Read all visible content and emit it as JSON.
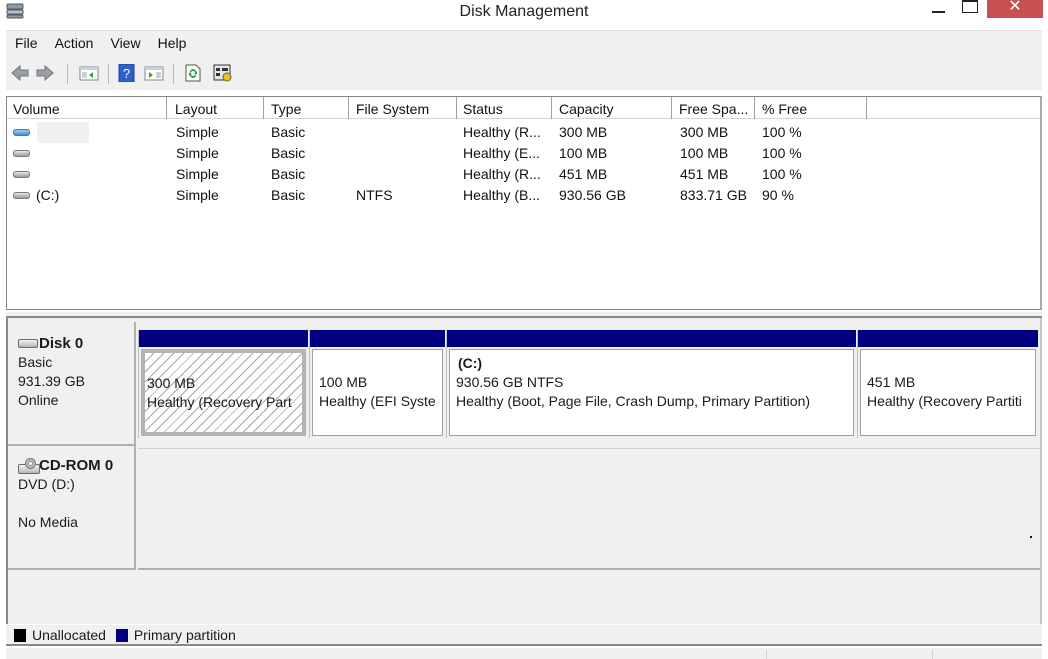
{
  "window": {
    "title": "Disk Management",
    "close_glyph": "✕"
  },
  "menu": [
    "File",
    "Action",
    "View",
    "Help"
  ],
  "toolbar": {
    "buttons": [
      "back",
      "forward",
      "show-hide-console-tree",
      "help",
      "show-hide-action-pane",
      "refresh",
      "properties"
    ]
  },
  "volumes": {
    "columns": [
      "Volume",
      "Layout",
      "Type",
      "File System",
      "Status",
      "Capacity",
      "Free Spa...",
      "% Free"
    ],
    "rows": [
      {
        "volume": "",
        "icon": "blue",
        "layout": "Simple",
        "type": "Basic",
        "fs": "",
        "status": "Healthy (R...",
        "capacity": "300 MB",
        "free": "300 MB",
        "pct": "100 %"
      },
      {
        "volume": "",
        "icon": "gray",
        "layout": "Simple",
        "type": "Basic",
        "fs": "",
        "status": "Healthy (E...",
        "capacity": "100 MB",
        "free": "100 MB",
        "pct": "100 %"
      },
      {
        "volume": "",
        "icon": "gray",
        "layout": "Simple",
        "type": "Basic",
        "fs": "",
        "status": "Healthy (R...",
        "capacity": "451 MB",
        "free": "451 MB",
        "pct": "100 %"
      },
      {
        "volume": "(C:)",
        "icon": "gray",
        "layout": "Simple",
        "type": "Basic",
        "fs": "NTFS",
        "status": "Healthy (B...",
        "capacity": "930.56 GB",
        "free": "833.71 GB",
        "pct": "90 %"
      }
    ]
  },
  "disks": [
    {
      "name": "Disk 0",
      "type": "Basic",
      "size": "931.39 GB",
      "state": "Online",
      "partitions": [
        {
          "volume": "",
          "size": "300 MB",
          "status": "Healthy (Recovery Part",
          "selected": true
        },
        {
          "volume": "",
          "size": "100 MB",
          "status": "Healthy (EFI Syste",
          "selected": false
        },
        {
          "volume": "(C:)",
          "size": "930.56 GB NTFS",
          "status": "Healthy (Boot, Page File, Crash Dump, Primary Partition)",
          "selected": false
        },
        {
          "volume": "",
          "size": "451 MB",
          "status": "Healthy (Recovery Partiti",
          "selected": false
        }
      ]
    },
    {
      "name": "CD-ROM 0",
      "type": "DVD (D:)",
      "size": "",
      "state": "No Media"
    }
  ],
  "legend": [
    {
      "label": "Unallocated",
      "color": "#000000"
    },
    {
      "label": "Primary partition",
      "color": "#000080"
    }
  ]
}
